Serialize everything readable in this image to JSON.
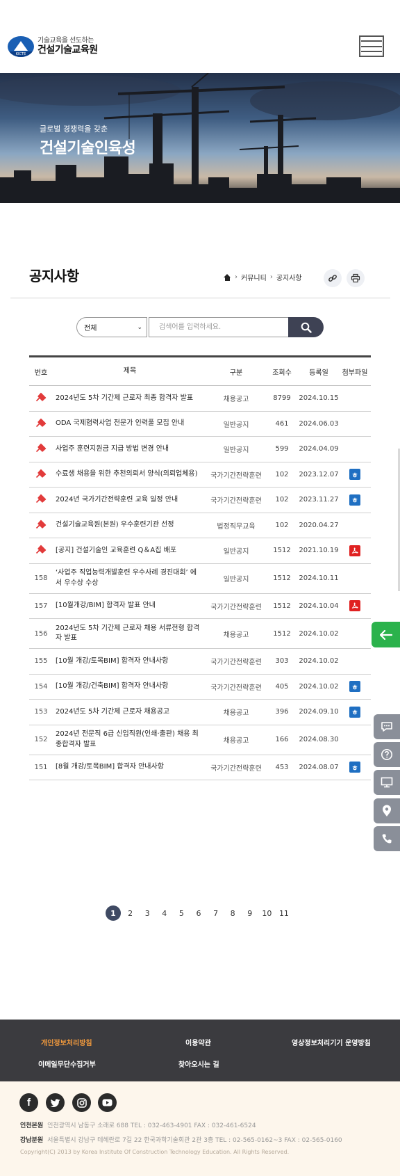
{
  "header": {
    "logo_badge": "KICTE",
    "logo_sub": "기술교육을 선도하는",
    "logo_main": "건설기술교육원"
  },
  "hero": {
    "subtitle": "글로벌 경쟁력을 갖춘",
    "title": "건설기술인육성"
  },
  "page": {
    "title": "공지사항",
    "breadcrumb": [
      "커뮤니티",
      "공지사항"
    ]
  },
  "search": {
    "select_value": "전체",
    "placeholder": "검색어를 입력하세요."
  },
  "table": {
    "headers": [
      "번호",
      "제목",
      "구분",
      "조회수",
      "등록일",
      "첨부파일"
    ],
    "rows": [
      {
        "no": "",
        "notice": true,
        "title": "2024년도 5차 기간제 근로자 최종 합격자 발표",
        "category": "채용공고",
        "views": "8799",
        "date": "2024.10.15",
        "file": ""
      },
      {
        "no": "",
        "notice": true,
        "title": "ODA 국제협력사업 전문가 인력풀 모집 안내",
        "category": "일반공지",
        "views": "461",
        "date": "2024.06.03",
        "file": ""
      },
      {
        "no": "",
        "notice": true,
        "title": "사업주 훈련지원금 지급 방법 변경 안내",
        "category": "일반공지",
        "views": "599",
        "date": "2024.04.09",
        "file": ""
      },
      {
        "no": "",
        "notice": true,
        "title": "수료생 채용을 위한 추천의뢰서 양식(의뢰업체용)",
        "category": "국가기간전략훈련",
        "views": "102",
        "date": "2023.12.07",
        "file": "hwp"
      },
      {
        "no": "",
        "notice": true,
        "title": "2024년 국가기간전략훈련 교육 일정 안내",
        "category": "국가기간전략훈련",
        "views": "102",
        "date": "2023.11.27",
        "file": "hwp"
      },
      {
        "no": "",
        "notice": true,
        "title": "건설기술교육원(본원) 우수훈련기관 선정",
        "category": "법정직무교육",
        "views": "102",
        "date": "2020.04.27",
        "file": ""
      },
      {
        "no": "",
        "notice": true,
        "title": "[공지] 건설기술인 교육훈련 Q＆A집 배포",
        "category": "일반공지",
        "views": "1512",
        "date": "2021.10.19",
        "file": "pdf"
      },
      {
        "no": "158",
        "notice": false,
        "title": "‘사업주 직업능력개발훈련 우수사례 경진대회’ 에서 우수상 수상",
        "category": "일반공지",
        "views": "1512",
        "date": "2024.10.11",
        "file": ""
      },
      {
        "no": "157",
        "notice": false,
        "title": "[10월개강/BIM] 합격자 발표 안내",
        "category": "국가기간전략훈련",
        "views": "1512",
        "date": "2024.10.04",
        "file": "pdf"
      },
      {
        "no": "156",
        "notice": false,
        "title": "2024년도 5차 기간제 근로자 채용 서류전형 합격자 발표",
        "category": "채용공고",
        "views": "1512",
        "date": "2024.10.02",
        "file": ""
      },
      {
        "no": "155",
        "notice": false,
        "title": "[10월 개강/토목BIM] 합격자 안내사항",
        "category": "국가기간전략훈련",
        "views": "303",
        "date": "2024.10.02",
        "file": ""
      },
      {
        "no": "154",
        "notice": false,
        "title": "[10월 개강/건축BIM] 합격자 안내사항",
        "category": "국가기간전략훈련",
        "views": "405",
        "date": "2024.10.02",
        "file": "hwp"
      },
      {
        "no": "153",
        "notice": false,
        "title": "2024년도 5차 기간제 근로자 채용공고",
        "category": "채용공고",
        "views": "396",
        "date": "2024.09.10",
        "file": "hwp"
      },
      {
        "no": "152",
        "notice": false,
        "title": "2024년 전문직 6급 신입직원(인쇄·출판) 채용 최종합격자 발표",
        "category": "채용공고",
        "views": "166",
        "date": "2024.08.30",
        "file": ""
      },
      {
        "no": "151",
        "notice": false,
        "title": "[8월 개강/토목BIM] 합격자 안내사항",
        "category": "국가기간전략훈련",
        "views": "453",
        "date": "2024.08.07",
        "file": "hwp"
      }
    ]
  },
  "pagination": {
    "pages": [
      "1",
      "2",
      "3",
      "4",
      "5",
      "6",
      "7",
      "8",
      "9",
      "10",
      "11"
    ],
    "current": "1"
  },
  "footer": {
    "links": [
      "개인정보처리방침",
      "이용약관",
      "영상정보처리기기 운영방침",
      "이메일무단수집거부",
      "찾아오시는 길"
    ],
    "social": [
      "facebook-icon",
      "twitter-icon",
      "instagram-icon",
      "youtube-icon"
    ],
    "incheon_label": "인천본원",
    "incheon_text": "인천광역시 남동구 소래로 688   TEL : 032-463-4901   FAX : 032-461-6524",
    "gangnam_label": "강남분원",
    "gangnam_text": "서울특별시 강남구 테헤란로 7길 22 한국과학기술회관 2관 3층   TEL : 02-565-0162~3   FAX : 02-565-0160",
    "copyright": "Copyright(C) 2013 by Korea Institute Of Construction Technology Education. All Rights Reserved."
  },
  "colors": {
    "accent": "#3e4254",
    "notice_red": "#e23b3b",
    "back_green": "#2bb24c",
    "footer_dark": "#3b3b3f",
    "footer_highlight": "#f29a3d"
  }
}
